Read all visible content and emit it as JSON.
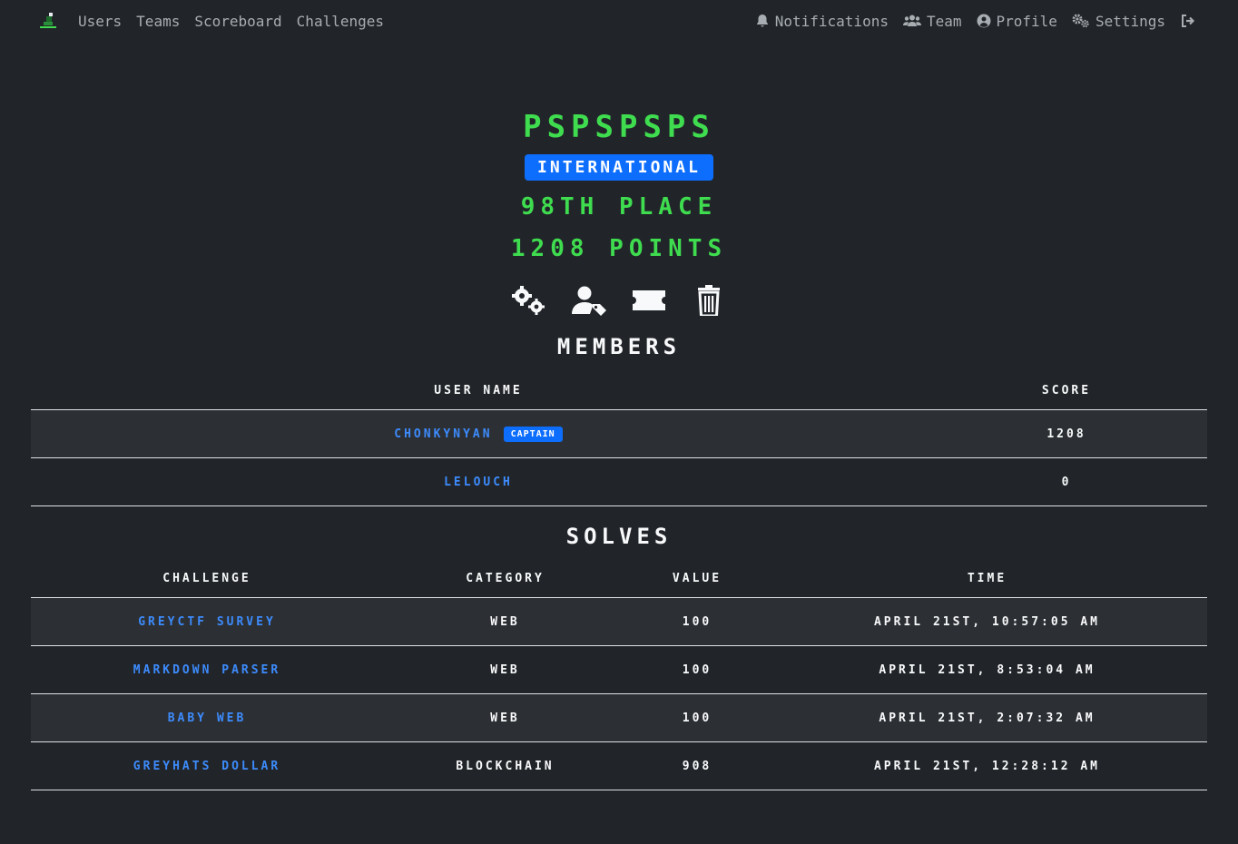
{
  "nav": {
    "links": [
      "Users",
      "Teams",
      "Scoreboard",
      "Challenges"
    ],
    "right": {
      "notifications": "Notifications",
      "team": "Team",
      "profile": "Profile",
      "settings": "Settings"
    }
  },
  "team": {
    "name": "PSPSPSPS",
    "affiliation": "INTERNATIONAL",
    "place": "98TH PLACE",
    "points": "1208 POINTS"
  },
  "actions": [
    "gears-icon",
    "user-tag-icon",
    "ticket-icon",
    "trash-icon"
  ],
  "members": {
    "title": "MEMBERS",
    "headers": [
      "USER NAME",
      "SCORE"
    ],
    "rows": [
      {
        "name": "CHONKYNYAN",
        "badge": "CAPTAIN",
        "score": "1208"
      },
      {
        "name": "LELOUCH",
        "badge": "",
        "score": "0"
      }
    ]
  },
  "solves": {
    "title": "SOLVES",
    "headers": [
      "CHALLENGE",
      "CATEGORY",
      "VALUE",
      "TIME"
    ],
    "rows": [
      {
        "challenge": "GREYCTF SURVEY",
        "category": "WEB",
        "value": "100",
        "time": "APRIL 21ST, 10:57:05 AM"
      },
      {
        "challenge": "MARKDOWN PARSER",
        "category": "WEB",
        "value": "100",
        "time": "APRIL 21ST, 8:53:04 AM"
      },
      {
        "challenge": "BABY WEB",
        "category": "WEB",
        "value": "100",
        "time": "APRIL 21ST, 2:07:32 AM"
      },
      {
        "challenge": "GREYHATS DOLLAR",
        "category": "BLOCKCHAIN",
        "value": "908",
        "time": "APRIL 21ST, 12:28:12 AM"
      }
    ]
  },
  "colors": {
    "background": "#212529",
    "accent_green": "#3fdc4f",
    "badge_blue": "#0d6efd",
    "link_blue": "#3d8bfd"
  }
}
